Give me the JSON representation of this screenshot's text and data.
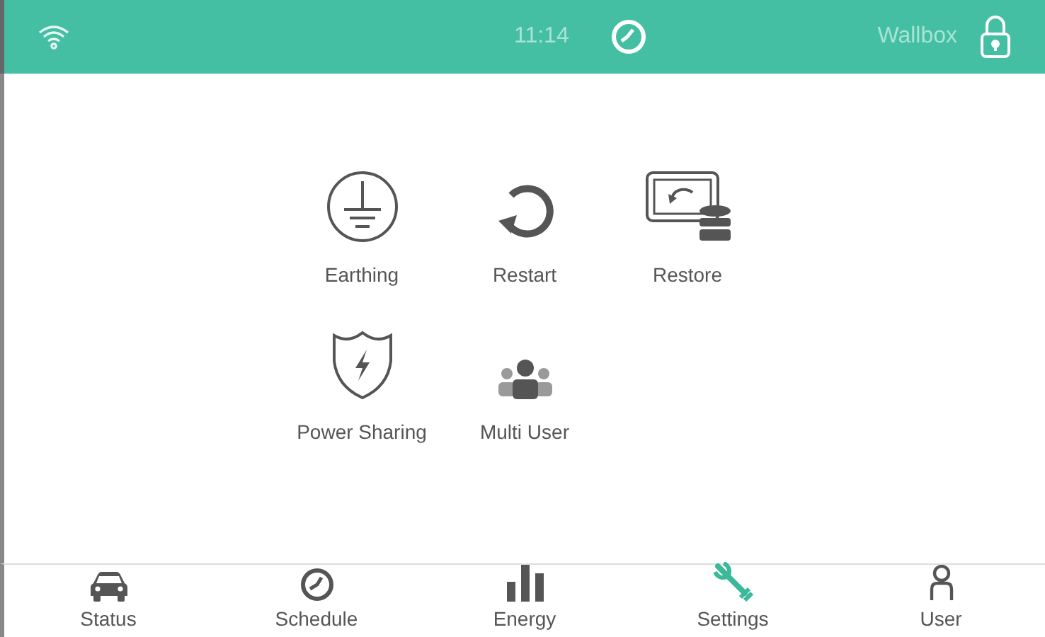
{
  "status_bar": {
    "time": "11:14",
    "device": "Wallbox"
  },
  "settings_items": [
    {
      "label": "Earthing",
      "kind": "earthing"
    },
    {
      "label": "Restart",
      "kind": "restart"
    },
    {
      "label": "Restore",
      "kind": "restore"
    },
    {
      "label": "Power Sharing",
      "kind": "power"
    },
    {
      "label": "Multi User",
      "kind": "users"
    }
  ],
  "nav_tabs": [
    {
      "label": "Status",
      "kind": "car",
      "selected": false
    },
    {
      "label": "Schedule",
      "kind": "clock",
      "selected": false
    },
    {
      "label": "Energy",
      "kind": "bars",
      "selected": false
    },
    {
      "label": "Settings",
      "kind": "wrench",
      "selected": true
    },
    {
      "label": "User",
      "kind": "user",
      "selected": false
    }
  ]
}
